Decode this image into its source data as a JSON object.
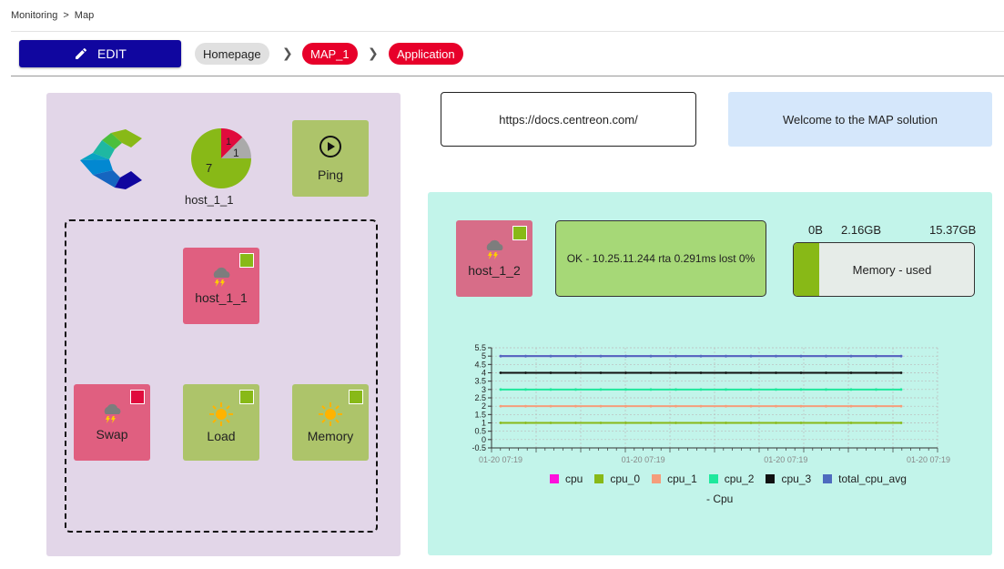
{
  "breadcrumb": {
    "items": [
      "Monitoring",
      "Map"
    ],
    "separator": ">"
  },
  "toolbar": {
    "edit_label": "EDIT",
    "crumbs": [
      "Homepage",
      "MAP_1",
      "Application"
    ]
  },
  "left_panel": {
    "pie": {
      "host": "host_1_1",
      "ok_count": "7",
      "critical_count": "1",
      "unknown_count": "1",
      "colors": {
        "ok": "#88b917",
        "critical": "#e00b3d",
        "unknown": "#aaaaaa"
      }
    },
    "ping_label": "Ping",
    "tiles": {
      "host_1_1": "host_1_1",
      "swap": "Swap",
      "load": "Load",
      "memory": "Memory"
    }
  },
  "links": {
    "url": "https://docs.centreon.com/",
    "welcome": "Welcome to the MAP solution"
  },
  "right_panel": {
    "host": "host_1_2",
    "ping_output": "OK - 10.25.11.244 rta 0.291ms lost 0%",
    "memory": {
      "min": "0B",
      "used": "2.16GB",
      "max": "15.37GB",
      "label": "Memory - used",
      "used_fraction": 0.14
    }
  },
  "colors": {
    "accent": "#10069f",
    "critical": "#e7002a",
    "ok": "#88b917"
  },
  "chart_data": {
    "type": "line",
    "title": "- Cpu",
    "x_ticks": [
      "01-20 07:19",
      "01-20 07:19",
      "01-20 07:19",
      "01-20 07:19"
    ],
    "y_ticks": [
      "5.5",
      "5",
      "4.5",
      "4",
      "3.5",
      "3",
      "2.5",
      "2",
      "1.5",
      "1",
      "0.5",
      "0",
      "-0.5"
    ],
    "ylim": [
      -0.5,
      5.5
    ],
    "series": [
      {
        "name": "cpu",
        "color": "#ff10dc",
        "value": 5
      },
      {
        "name": "cpu_0",
        "color": "#88b917",
        "value": 1
      },
      {
        "name": "cpu_1",
        "color": "#f59d7b",
        "value": 2
      },
      {
        "name": "cpu_2",
        "color": "#1ee89c",
        "value": 3
      },
      {
        "name": "cpu_3",
        "color": "#111111",
        "value": 4
      },
      {
        "name": "total_cpu_avg",
        "color": "#4e6bbf",
        "value": 5
      }
    ],
    "grid": true,
    "legend": "bottom"
  }
}
